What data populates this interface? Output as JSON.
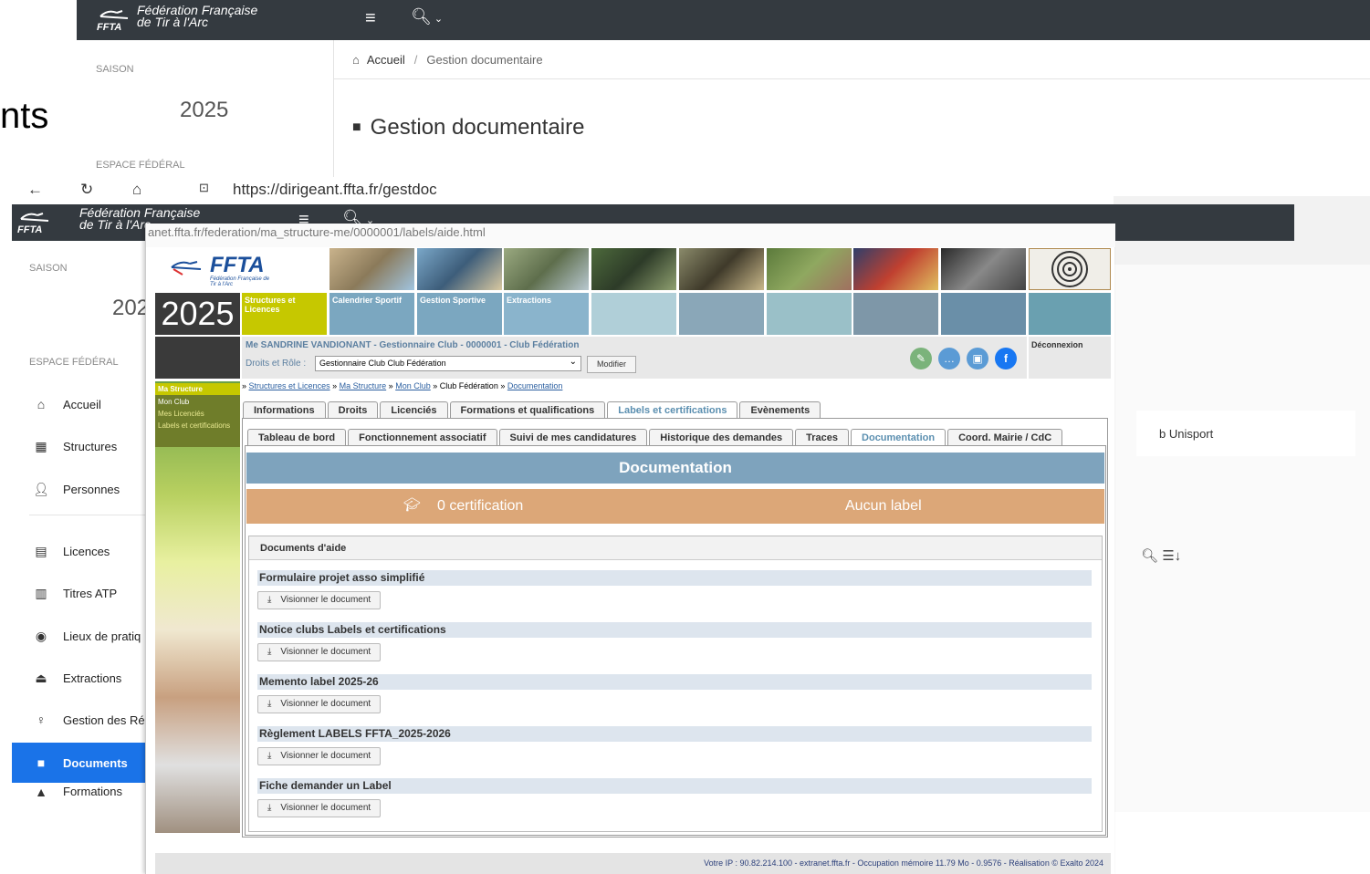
{
  "layer1": {
    "partial_heading": "nts",
    "brand_line1": "Fédération Française",
    "brand_line2": "de Tir à l'Arc",
    "brand_abbr": "FFTA",
    "season_label": "SAISON",
    "season_year": "2025",
    "espace_label": "ESPACE FÉDÉRAL",
    "breadcrumb_home": "Accueil",
    "breadcrumb_sep": "/",
    "breadcrumb_current": "Gestion documentaire",
    "page_title": "Gestion documentaire"
  },
  "layer2": {
    "url": "https://dirigeant.ffta.fr/gestdoc",
    "brand_line1": "Fédération Française",
    "brand_line2": "de Tir à l'Arc",
    "brand_abbr": "FFTA",
    "season_label": "SAISON",
    "season_year_partial": "202",
    "espace_label": "ESPACE FÉDÉRAL",
    "nav": [
      {
        "label": "Accueil",
        "icon": "home-icon"
      },
      {
        "label": "Structures",
        "icon": "building-icon"
      },
      {
        "label": "Personnes",
        "icon": "person-icon"
      },
      {
        "label": "Licences",
        "icon": "card-icon"
      },
      {
        "label": "Titres ATP",
        "icon": "trophy-icon"
      },
      {
        "label": "Lieux de pratiq",
        "icon": "location-icon"
      },
      {
        "label": "Extractions",
        "icon": "export-icon"
      },
      {
        "label": "Gestion des Ré",
        "icon": "pin-icon"
      },
      {
        "label": "Documents",
        "icon": "folder-icon"
      },
      {
        "label": "Formations",
        "icon": "grad-icon"
      }
    ],
    "right_text": "b Unisport"
  },
  "layer3": {
    "url_partial": "anet.ffta.fr/federation/ma_structure-me/0000001/labels/aide.html",
    "logo_text": "FFTA",
    "logo_sub": "Fédération Française de Tir à l'Arc",
    "year": "2025",
    "tiles": [
      "Structures et Licences",
      "Calendrier Sportif",
      "Gestion Sportive",
      "Extractions"
    ],
    "user_line": "Me SANDRINE VANDIONANT - Gestionnaire Club - 0000001 - Club Fédération",
    "role_label": "Droits et Rôle :",
    "role_value": "Gestionnaire Club Club Fédération",
    "modify_btn": "Modifier",
    "logout": "Déconnexion",
    "left_menu": {
      "header": "Ma Structure",
      "items": [
        "Mon Club",
        "Mes Licenciés",
        "Labels et certifications"
      ]
    },
    "breadcrumb": {
      "prefix": "»",
      "items": [
        "Structures et Licences",
        "Ma Structure",
        "Mon Club",
        "Club Fédération",
        "Documentation"
      ],
      "sep": "»"
    },
    "tabs1": [
      "Informations",
      "Droits",
      "Licenciés",
      "Formations et qualifications",
      "Labels et certifications",
      "Evènements"
    ],
    "tabs2": [
      "Tableau de bord",
      "Fonctionnement associatif",
      "Suivi de mes candidatures",
      "Historique des demandes",
      "Traces",
      "Documentation",
      "Coord. Mairie / CdC"
    ],
    "doc_header": "Documentation",
    "certification_text": "0 certification",
    "label_text": "Aucun label",
    "docs_section_title": "Documents d'aide",
    "documents": [
      {
        "title": "Formulaire projet asso simplifié",
        "button": "Visionner le document"
      },
      {
        "title": "Notice clubs Labels et certifications",
        "button": "Visionner le document"
      },
      {
        "title": "Memento label 2025-26",
        "button": "Visionner le document"
      },
      {
        "title": "Règlement LABELS FFTA_2025-2026",
        "button": "Visionner le document"
      },
      {
        "title": "Fiche demander un Label",
        "button": "Visionner le document"
      }
    ],
    "footer": "Votre IP : 90.82.214.100 - extranet.ffta.fr - Occupation mémoire 11.79 Mo - 0.9576 - Réalisation © Exalto 2024"
  },
  "colors": {
    "dark_header": "#343a40",
    "active_nav": "#1a73e8",
    "doc_header_bg": "#7ea3bd",
    "cert_banner": "#dca778",
    "tile_yellow": "#c6c800",
    "tile_blue": "#7ba7c0"
  }
}
